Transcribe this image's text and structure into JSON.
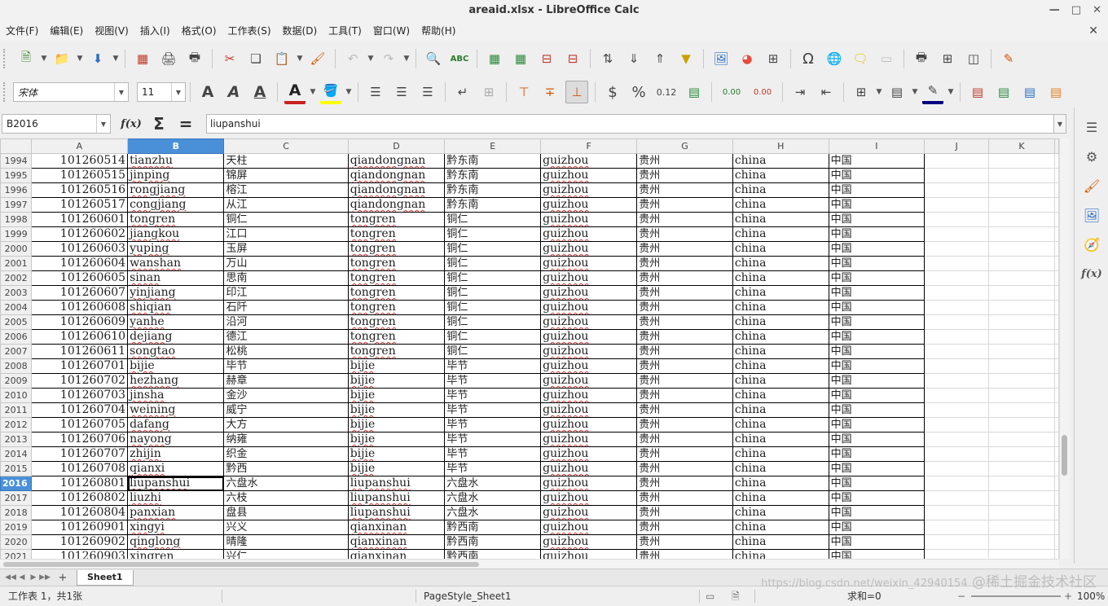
{
  "window": {
    "title": "areaid.xlsx - LibreOffice Calc"
  },
  "menu": [
    "文件(F)",
    "编辑(E)",
    "视图(V)",
    "插入(I)",
    "格式(O)",
    "工作表(S)",
    "数据(D)",
    "工具(T)",
    "窗口(W)",
    "帮助(H)"
  ],
  "format": {
    "font_name": "宋体",
    "font_size": "11",
    "number_format_label": "0.12",
    "dec_add_label": "0.00",
    "dec_del_label": "0.00"
  },
  "formula": {
    "name_box": "B2016",
    "content": "liupanshui"
  },
  "columns": [
    "A",
    "B",
    "C",
    "D",
    "E",
    "F",
    "G",
    "H",
    "I",
    "J",
    "K"
  ],
  "selected_column": "B",
  "selected_row": "2016",
  "rows": [
    {
      "n": "1994",
      "id": "101260514",
      "py": "tianzhu",
      "cn": "天柱",
      "ppy": "qiandongnan",
      "pcn": "黔东南",
      "prov": "guizhou",
      "provcn": "贵州",
      "country": "china",
      "countrycn": "中国"
    },
    {
      "n": "1995",
      "id": "101260515",
      "py": "jinping",
      "cn": "锦屏",
      "ppy": "qiandongnan",
      "pcn": "黔东南",
      "prov": "guizhou",
      "provcn": "贵州",
      "country": "china",
      "countrycn": "中国"
    },
    {
      "n": "1996",
      "id": "101260516",
      "py": "rongjiang",
      "cn": "榕江",
      "ppy": "qiandongnan",
      "pcn": "黔东南",
      "prov": "guizhou",
      "provcn": "贵州",
      "country": "china",
      "countrycn": "中国"
    },
    {
      "n": "1997",
      "id": "101260517",
      "py": "congjiang",
      "cn": "从江",
      "ppy": "qiandongnan",
      "pcn": "黔东南",
      "prov": "guizhou",
      "provcn": "贵州",
      "country": "china",
      "countrycn": "中国"
    },
    {
      "n": "1998",
      "id": "101260601",
      "py": "tongren",
      "cn": "铜仁",
      "ppy": "tongren",
      "pcn": "铜仁",
      "prov": "guizhou",
      "provcn": "贵州",
      "country": "china",
      "countrycn": "中国"
    },
    {
      "n": "1999",
      "id": "101260602",
      "py": "jiangkou",
      "cn": "江口",
      "ppy": "tongren",
      "pcn": "铜仁",
      "prov": "guizhou",
      "provcn": "贵州",
      "country": "china",
      "countrycn": "中国"
    },
    {
      "n": "2000",
      "id": "101260603",
      "py": "yuping",
      "cn": "玉屏",
      "ppy": "tongren",
      "pcn": "铜仁",
      "prov": "guizhou",
      "provcn": "贵州",
      "country": "china",
      "countrycn": "中国"
    },
    {
      "n": "2001",
      "id": "101260604",
      "py": "wanshan",
      "cn": "万山",
      "ppy": "tongren",
      "pcn": "铜仁",
      "prov": "guizhou",
      "provcn": "贵州",
      "country": "china",
      "countrycn": "中国"
    },
    {
      "n": "2002",
      "id": "101260605",
      "py": "sinan",
      "cn": "思南",
      "ppy": "tongren",
      "pcn": "铜仁",
      "prov": "guizhou",
      "provcn": "贵州",
      "country": "china",
      "countrycn": "中国"
    },
    {
      "n": "2003",
      "id": "101260607",
      "py": "yinjiang",
      "cn": "印江",
      "ppy": "tongren",
      "pcn": "铜仁",
      "prov": "guizhou",
      "provcn": "贵州",
      "country": "china",
      "countrycn": "中国"
    },
    {
      "n": "2004",
      "id": "101260608",
      "py": "shiqian",
      "cn": "石阡",
      "ppy": "tongren",
      "pcn": "铜仁",
      "prov": "guizhou",
      "provcn": "贵州",
      "country": "china",
      "countrycn": "中国"
    },
    {
      "n": "2005",
      "id": "101260609",
      "py": "yanhe",
      "cn": "沿河",
      "ppy": "tongren",
      "pcn": "铜仁",
      "prov": "guizhou",
      "provcn": "贵州",
      "country": "china",
      "countrycn": "中国"
    },
    {
      "n": "2006",
      "id": "101260610",
      "py": "dejiang",
      "cn": "德江",
      "ppy": "tongren",
      "pcn": "铜仁",
      "prov": "guizhou",
      "provcn": "贵州",
      "country": "china",
      "countrycn": "中国"
    },
    {
      "n": "2007",
      "id": "101260611",
      "py": "songtao",
      "cn": "松桃",
      "ppy": "tongren",
      "pcn": "铜仁",
      "prov": "guizhou",
      "provcn": "贵州",
      "country": "china",
      "countrycn": "中国"
    },
    {
      "n": "2008",
      "id": "101260701",
      "py": "bijie",
      "cn": "毕节",
      "ppy": "bijie",
      "pcn": "毕节",
      "prov": "guizhou",
      "provcn": "贵州",
      "country": "china",
      "countrycn": "中国"
    },
    {
      "n": "2009",
      "id": "101260702",
      "py": "hezhang",
      "cn": "赫章",
      "ppy": "bijie",
      "pcn": "毕节",
      "prov": "guizhou",
      "provcn": "贵州",
      "country": "china",
      "countrycn": "中国"
    },
    {
      "n": "2010",
      "id": "101260703",
      "py": "jinsha",
      "cn": "金沙",
      "ppy": "bijie",
      "pcn": "毕节",
      "prov": "guizhou",
      "provcn": "贵州",
      "country": "china",
      "countrycn": "中国"
    },
    {
      "n": "2011",
      "id": "101260704",
      "py": "weining",
      "cn": "威宁",
      "ppy": "bijie",
      "pcn": "毕节",
      "prov": "guizhou",
      "provcn": "贵州",
      "country": "china",
      "countrycn": "中国"
    },
    {
      "n": "2012",
      "id": "101260705",
      "py": "dafang",
      "cn": "大方",
      "ppy": "bijie",
      "pcn": "毕节",
      "prov": "guizhou",
      "provcn": "贵州",
      "country": "china",
      "countrycn": "中国"
    },
    {
      "n": "2013",
      "id": "101260706",
      "py": "nayong",
      "cn": "纳雍",
      "ppy": "bijie",
      "pcn": "毕节",
      "prov": "guizhou",
      "provcn": "贵州",
      "country": "china",
      "countrycn": "中国"
    },
    {
      "n": "2014",
      "id": "101260707",
      "py": "zhijin",
      "cn": "织金",
      "ppy": "bijie",
      "pcn": "毕节",
      "prov": "guizhou",
      "provcn": "贵州",
      "country": "china",
      "countrycn": "中国"
    },
    {
      "n": "2015",
      "id": "101260708",
      "py": "qianxi",
      "cn": "黔西",
      "ppy": "bijie",
      "pcn": "毕节",
      "prov": "guizhou",
      "provcn": "贵州",
      "country": "china",
      "countrycn": "中国"
    },
    {
      "n": "2016",
      "id": "101260801",
      "py": "liupanshui",
      "cn": "六盘水",
      "ppy": "liupanshui",
      "pcn": "六盘水",
      "prov": "guizhou",
      "provcn": "贵州",
      "country": "china",
      "countrycn": "中国"
    },
    {
      "n": "2017",
      "id": "101260802",
      "py": "liuzhi",
      "cn": "六枝",
      "ppy": "liupanshui",
      "pcn": "六盘水",
      "prov": "guizhou",
      "provcn": "贵州",
      "country": "china",
      "countrycn": "中国"
    },
    {
      "n": "2018",
      "id": "101260804",
      "py": "panxian",
      "cn": "盘县",
      "ppy": "liupanshui",
      "pcn": "六盘水",
      "prov": "guizhou",
      "provcn": "贵州",
      "country": "china",
      "countrycn": "中国"
    },
    {
      "n": "2019",
      "id": "101260901",
      "py": "xingyi",
      "cn": "兴义",
      "ppy": "qianxinan",
      "pcn": "黔西南",
      "prov": "guizhou",
      "provcn": "贵州",
      "country": "china",
      "countrycn": "中国"
    },
    {
      "n": "2020",
      "id": "101260902",
      "py": "qinglong",
      "cn": "晴隆",
      "ppy": "qianxinan",
      "pcn": "黔西南",
      "prov": "guizhou",
      "provcn": "贵州",
      "country": "china",
      "countrycn": "中国"
    },
    {
      "n": "2021",
      "id": "101260903",
      "py": "xingren",
      "cn": "兴仁",
      "ppy": "qianxinan",
      "pcn": "黔西南",
      "prov": "guizhou",
      "provcn": "贵州",
      "country": "china",
      "countrycn": "中国"
    }
  ],
  "sheet_tab": "Sheet1",
  "status": {
    "sheet_info": "工作表 1，共1张",
    "page_style": "PageStyle_Sheet1",
    "sum": "求和=0",
    "zoom": "100%"
  },
  "watermark": "@稀土掘金技术社区",
  "watermark_url": "https://blog.csdn.net/weixin_42940154"
}
